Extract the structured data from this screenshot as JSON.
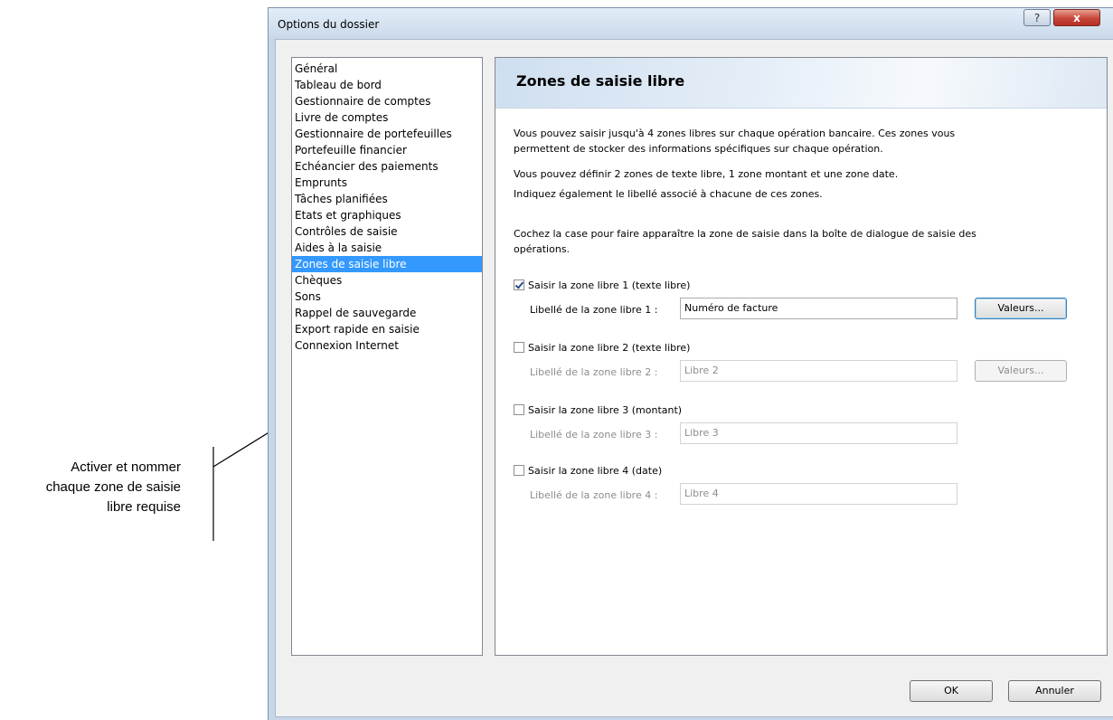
{
  "window": {
    "title": "Options du dossier",
    "help_glyph": "?",
    "close_glyph": "x"
  },
  "nav": {
    "items": [
      "Général",
      "Tableau de bord",
      "Gestionnaire de comptes",
      "Livre de comptes",
      "Gestionnaire de portefeuilles",
      "Portefeuille financier",
      "Echéancier des paiements",
      "Emprunts",
      "Tâches planifiées",
      "Etats et graphiques",
      "Contrôles de saisie",
      "Aides à la saisie",
      "Zones de saisie libre",
      "Chèques",
      "Sons",
      "Rappel de sauvegarde",
      "Export rapide en saisie",
      "Connexion Internet"
    ],
    "selected": "Zones de saisie libre"
  },
  "panel": {
    "title": "Zones de saisie libre",
    "intro_line1": "Vous pouvez saisir jusqu'à 4 zones libres sur chaque opération bancaire. Ces zones vous",
    "intro_line2": "permettent de stocker des informations spécifiques sur chaque opération.",
    "define_line": "Vous pouvez définir 2 zones de texte libre, 1 zone montant et une zone date.",
    "label_line": "Indiquez également le libellé associé à chacune de ces zones.",
    "check_line1": "Cochez la case pour faire apparaître la zone de saisie dans la boîte de dialogue de saisie des",
    "check_line2": "opérations."
  },
  "zones": [
    {
      "checkbox_label": "Saisir la zone libre 1 (texte libre)",
      "checked": true,
      "field_label": "Libellé de la zone libre 1 :",
      "value": "Numéro de facture",
      "button": "Valeurs..."
    },
    {
      "checkbox_label": "Saisir la zone libre 2 (texte libre)",
      "checked": false,
      "field_label": "Libellé de la zone libre 2 :",
      "value": "Libre 2",
      "button": "Valeurs..."
    },
    {
      "checkbox_label": "Saisir la zone libre 3 (montant)",
      "checked": false,
      "field_label": "Libellé de la zone libre 3 :",
      "value": "Libre 3"
    },
    {
      "checkbox_label": "Saisir la zone libre 4 (date)",
      "checked": false,
      "field_label": "Libellé de la zone libre 4 :",
      "value": "Libre 4"
    }
  ],
  "footer": {
    "ok_label": "OK",
    "cancel_label": "Annuler"
  },
  "callout": {
    "line1": "Activer et nommer",
    "line2": "chaque zone de saisie",
    "line3": "libre requise"
  },
  "colors": {
    "selection": "#3399ff",
    "window_frame": "#c5d6e8",
    "close_button": "#c7463a"
  }
}
